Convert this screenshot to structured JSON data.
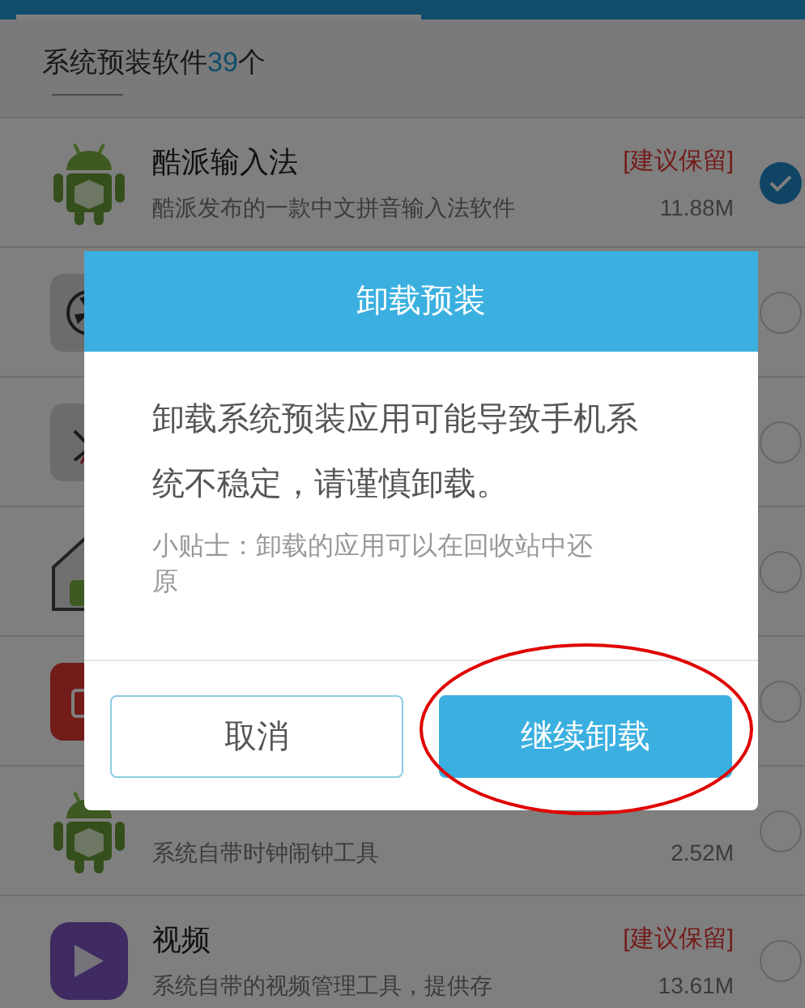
{
  "header": {
    "title": "系统预装软件",
    "count": "39",
    "suffix": "个"
  },
  "apps": [
    {
      "name": "酷派输入法",
      "tag": "[建议保留]",
      "description": "酷派发布的一款中文拼音输入法软件",
      "size": "11.88M",
      "checked": true
    },
    {
      "checked": false
    },
    {
      "checked": false
    },
    {
      "checked": false
    },
    {
      "checked": false
    },
    {
      "description": "系统自带时钟闹钟工具",
      "size": "2.52M",
      "checked": false
    },
    {
      "name": "视频",
      "tag": "[建议保留]",
      "description": "系统自带的视频管理工具，提供存",
      "size": "13.61M",
      "checked": false
    }
  ],
  "dialog": {
    "title": "卸载预装",
    "message": "卸载系统预装应用可能导致手机系统不稳定，请谨慎卸载。",
    "tip": "小贴士：卸载的应用可以在回收站中还原",
    "buttons": [
      {
        "label": "取消",
        "primary": false,
        "circled": false
      },
      {
        "label": "继续卸载",
        "primary": true,
        "circled": true
      }
    ]
  }
}
